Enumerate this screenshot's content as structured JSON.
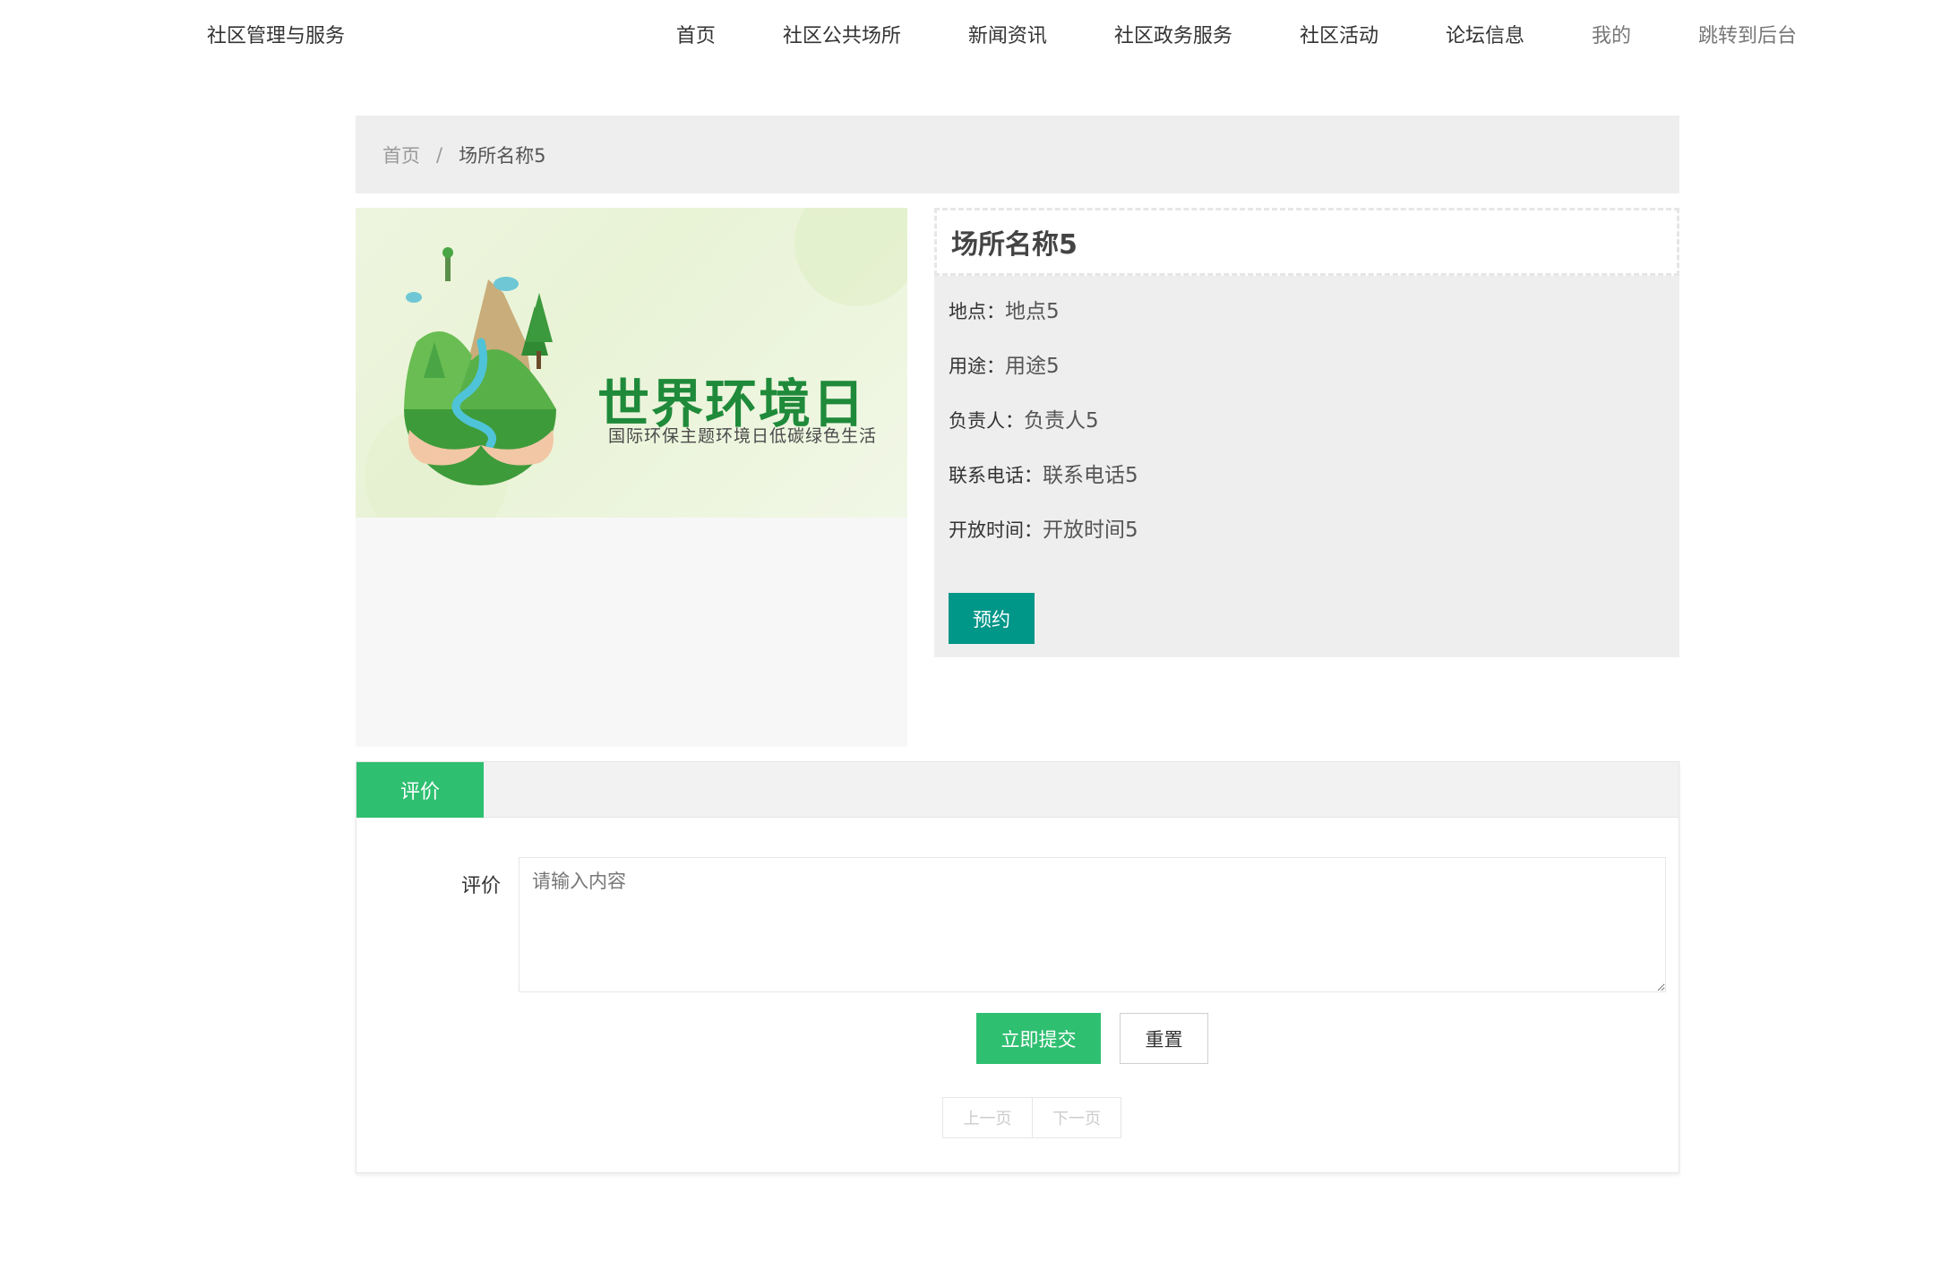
{
  "header": {
    "brand": "社区管理与服务",
    "nav": [
      {
        "label": "首页"
      },
      {
        "label": "社区公共场所"
      },
      {
        "label": "新闻资讯"
      },
      {
        "label": "社区政务服务"
      },
      {
        "label": "社区活动"
      },
      {
        "label": "论坛信息"
      },
      {
        "label": "我的"
      },
      {
        "label": "跳转到后台"
      }
    ]
  },
  "breadcrumb": {
    "home": "首页",
    "separator": "/",
    "current": "场所名称5"
  },
  "banner": {
    "title": "世界环境日",
    "subtitle": "国际环保主题环境日低碳绿色生活"
  },
  "place": {
    "name": "场所名称5",
    "fields": [
      {
        "label": "地点：",
        "value": "地点5"
      },
      {
        "label": "用途：",
        "value": "用途5"
      },
      {
        "label": "负责人：",
        "value": "负责人5"
      },
      {
        "label": "联系电话：",
        "value": "联系电话5"
      },
      {
        "label": "开放时间：",
        "value": "开放时间5"
      }
    ],
    "book_label": "预约"
  },
  "review": {
    "tab_label": "评价",
    "field_label": "评价",
    "placeholder": "请输入内容",
    "submit_label": "立即提交",
    "reset_label": "重置",
    "prev_label": "上一页",
    "next_label": "下一页"
  },
  "colors": {
    "accent_green": "#2fbf71",
    "teal": "#009688"
  }
}
